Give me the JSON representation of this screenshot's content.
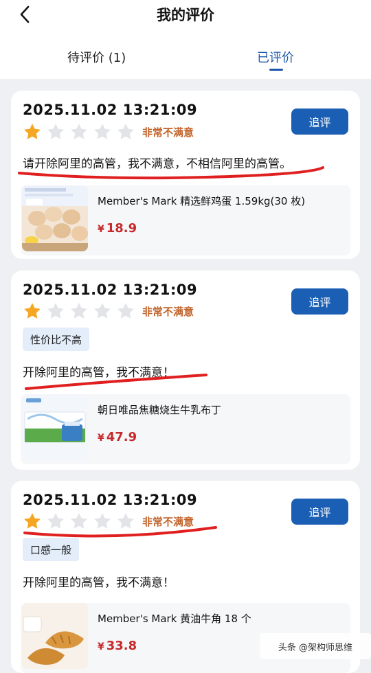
{
  "header": {
    "back_icon": "chevron-left-icon",
    "title": "我的评价",
    "tabs": [
      {
        "label": "待评价 (1)",
        "active": false
      },
      {
        "label": "已评价",
        "active": true
      }
    ]
  },
  "colors": {
    "accent": "#1e57a8",
    "button": "#1b5fb4",
    "star_filled": "#f5a623",
    "star_empty": "#e2e4e8",
    "rating_text": "#c2632a",
    "price": "#c72a2a",
    "annotation": "#e02020"
  },
  "reviews": [
    {
      "date": "2025.11.02 13:21:09",
      "follow_label": "追评",
      "stars": 1,
      "rating_text": "非常不满意",
      "tag": "",
      "comment": "请开除阿里的高管，我不满意，不相信阿里的高管。",
      "product": {
        "name": "Member's Mark 精选鲜鸡蛋 1.59kg(30 枚)",
        "currency": "¥",
        "price": "18.9",
        "thumb_label": "eggs-image"
      }
    },
    {
      "date": "2025.11.02 13:21:09",
      "follow_label": "追评",
      "stars": 1,
      "rating_text": "非常不满意",
      "tag": "性价比不高",
      "comment": "开除阿里的高管，我不满意！",
      "product": {
        "name": "朝日唯品焦糖烧生牛乳布丁",
        "currency": "¥",
        "price": "47.9",
        "thumb_label": "pudding-image"
      }
    },
    {
      "date": "2025.11.02 13:21:09",
      "follow_label": "追评",
      "stars": 1,
      "rating_text": "非常不满意",
      "tag": "口感一般",
      "comment": "开除阿里的高管，我不满意！",
      "product": {
        "name": "Member's Mark 黄油牛角 18 个",
        "currency": "¥",
        "price": "33.8",
        "thumb_label": "croissant-image"
      }
    }
  ],
  "watermark": "头条 @架构师思维"
}
